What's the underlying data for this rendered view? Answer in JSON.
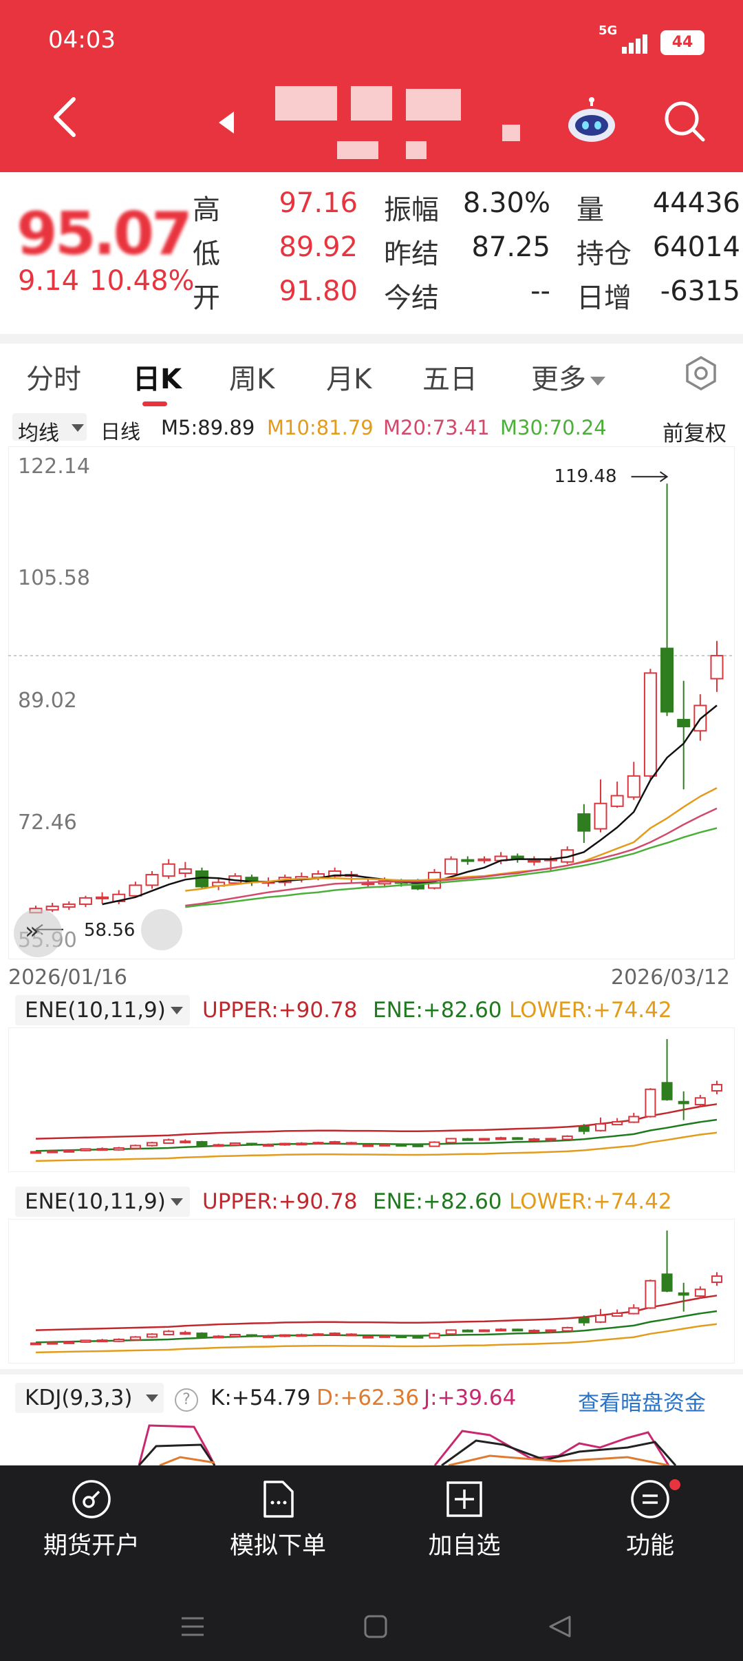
{
  "status_bar": {
    "time": "04:03",
    "network": "5G",
    "battery": "44"
  },
  "quote": {
    "price_obscured": "95.07",
    "change": "9.14",
    "change_pct": "10.48%",
    "rows": [
      [
        {
          "label": "高",
          "value": "97.16",
          "color": "red"
        },
        {
          "label": "振幅",
          "value": "8.30%",
          "color": "dark"
        },
        {
          "label": "量",
          "value": "44436",
          "color": "dark"
        }
      ],
      [
        {
          "label": "低",
          "value": "89.92",
          "color": "red"
        },
        {
          "label": "昨结",
          "value": "87.25",
          "color": "dark"
        },
        {
          "label": "持仓",
          "value": "64014",
          "color": "dark"
        }
      ],
      [
        {
          "label": "开",
          "value": "91.80",
          "color": "red"
        },
        {
          "label": "今结",
          "value": "--",
          "color": "dark"
        },
        {
          "label": "日增",
          "value": "-6315",
          "color": "dark"
        }
      ]
    ]
  },
  "tabs": [
    "分时",
    "日K",
    "周K",
    "月K",
    "五日",
    "更多"
  ],
  "ma_bar": {
    "avg_label": "均线",
    "line_type": "日线",
    "m5": "M5:89.89",
    "m10": "M10:81.79",
    "m20": "M20:73.41",
    "m30": "M30:70.24",
    "adjust": "前复权"
  },
  "colors": {
    "brand": "#e8343e",
    "up": "#d9363e",
    "down": "#2e7d1e",
    "m5": "#111111",
    "m10": "#e39b1b",
    "m20": "#d14a6b",
    "m30": "#4caf3a"
  },
  "chart_data": {
    "type": "candlestick",
    "ylim": [
      55.9,
      122.14
    ],
    "y_ticks": [
      "122.14",
      "105.58",
      "89.02",
      "72.46",
      "55.90"
    ],
    "y_tick_values": [
      122.14,
      105.58,
      89.02,
      72.46,
      55.9
    ],
    "high_label": "119.48",
    "low_label": "58.56",
    "date_start": "2026/01/16",
    "date_end": "2026/03/12",
    "current_price": 95.07,
    "candles": [
      [
        58.6,
        59.2,
        58.56,
        59.6
      ],
      [
        59.0,
        59.5,
        58.7,
        60.0
      ],
      [
        59.4,
        59.8,
        59.0,
        60.2
      ],
      [
        59.8,
        60.7,
        59.4,
        61.0
      ],
      [
        60.6,
        60.8,
        59.9,
        61.5
      ],
      [
        60.2,
        61.2,
        59.8,
        61.8
      ],
      [
        61.0,
        62.5,
        60.8,
        63.0
      ],
      [
        62.5,
        64.0,
        62.0,
        64.5
      ],
      [
        63.8,
        65.5,
        63.4,
        66.2
      ],
      [
        64.2,
        64.8,
        63.6,
        65.8
      ],
      [
        64.5,
        62.3,
        62.0,
        65.0
      ],
      [
        62.4,
        62.9,
        61.8,
        63.5
      ],
      [
        62.8,
        63.8,
        62.5,
        64.2
      ],
      [
        63.6,
        62.9,
        62.4,
        64.0
      ],
      [
        63.0,
        63.0,
        62.3,
        63.6
      ],
      [
        62.9,
        63.6,
        62.4,
        64.0
      ],
      [
        63.4,
        63.7,
        62.9,
        64.3
      ],
      [
        63.6,
        64.1,
        63.2,
        64.6
      ],
      [
        63.8,
        64.5,
        63.4,
        65.0
      ],
      [
        64.0,
        64.0,
        62.9,
        64.5
      ],
      [
        62.8,
        62.8,
        62.3,
        63.3
      ],
      [
        62.7,
        63.1,
        62.3,
        63.6
      ],
      [
        63.0,
        62.9,
        62.3,
        63.4
      ],
      [
        63.0,
        62.0,
        61.8,
        63.4
      ],
      [
        62.1,
        64.3,
        61.9,
        64.8
      ],
      [
        64.1,
        66.2,
        64.0,
        66.6
      ],
      [
        66.1,
        66.0,
        65.4,
        66.6
      ],
      [
        66.0,
        66.2,
        65.6,
        66.6
      ],
      [
        66.0,
        66.6,
        65.5,
        67.2
      ],
      [
        66.6,
        66.2,
        65.7,
        67.0
      ],
      [
        66.0,
        66.0,
        65.3,
        66.6
      ],
      [
        66.0,
        66.2,
        64.5,
        66.6
      ],
      [
        65.8,
        67.5,
        65.5,
        68.0
      ],
      [
        72.6,
        70.2,
        68.5,
        74.0
      ],
      [
        70.5,
        74.1,
        70.0,
        77.5
      ],
      [
        73.7,
        75.2,
        73.5,
        77.2
      ],
      [
        75.0,
        78.0,
        74.6,
        80.0
      ],
      [
        78.0,
        92.6,
        77.5,
        93.2
      ],
      [
        96.1,
        87.1,
        86.5,
        119.48
      ],
      [
        86.0,
        85.0,
        76.1,
        91.5
      ],
      [
        84.4,
        88.0,
        83.0,
        89.6
      ],
      [
        91.8,
        95.07,
        89.92,
        97.16
      ]
    ],
    "ma_series": [
      {
        "name": "M5",
        "values": [
          null,
          null,
          null,
          null,
          59.8,
          60.3,
          60.8,
          61.7,
          62.6,
          63.3,
          63.6,
          63.5,
          63.2,
          63.0,
          63.0,
          63.1,
          63.3,
          63.5,
          63.9,
          63.9,
          63.6,
          63.3,
          63.0,
          62.8,
          63.0,
          63.7,
          64.4,
          65.0,
          66.0,
          66.2,
          66.2,
          66.2,
          66.5,
          67.2,
          68.9,
          70.7,
          72.9,
          77.4,
          80.6,
          82.6,
          86.1,
          88.0
        ]
      },
      {
        "name": "M10",
        "values": [
          null,
          null,
          null,
          null,
          null,
          null,
          null,
          null,
          null,
          61.7,
          62.0,
          62.4,
          62.6,
          62.9,
          63.0,
          63.3,
          63.4,
          63.5,
          63.5,
          63.4,
          63.4,
          63.3,
          63.2,
          63.2,
          63.3,
          63.5,
          63.7,
          63.8,
          64.1,
          64.4,
          64.6,
          64.9,
          65.3,
          65.9,
          66.8,
          67.7,
          68.6,
          70.6,
          72.0,
          73.6,
          75.1,
          76.3
        ]
      },
      {
        "name": "M20",
        "values": [
          null,
          null,
          null,
          null,
          null,
          null,
          null,
          null,
          null,
          59.6,
          59.9,
          60.3,
          60.7,
          61.1,
          61.5,
          61.8,
          62.1,
          62.4,
          62.7,
          62.8,
          62.9,
          63.0,
          63.0,
          63.0,
          63.1,
          63.3,
          63.5,
          63.7,
          64.0,
          64.2,
          64.6,
          64.9,
          65.3,
          65.8,
          66.3,
          66.9,
          67.6,
          68.6,
          69.8,
          71.1,
          72.3,
          73.4
        ]
      },
      {
        "name": "M30",
        "values": [
          null,
          null,
          null,
          null,
          null,
          null,
          null,
          null,
          null,
          59.4,
          59.7,
          59.9,
          60.2,
          60.5,
          60.8,
          61.0,
          61.3,
          61.5,
          61.8,
          62.0,
          62.2,
          62.3,
          62.5,
          62.6,
          62.8,
          63.0,
          63.2,
          63.4,
          63.6,
          63.9,
          64.2,
          64.5,
          64.9,
          65.3,
          65.8,
          66.4,
          67.0,
          67.8,
          68.5,
          69.3,
          70.0,
          70.6
        ]
      }
    ]
  },
  "indicators": [
    {
      "name": "ENE(10,11,9)",
      "upper": "UPPER:+90.78",
      "ene": "ENE:+82.60",
      "lower": "LOWER:+74.42"
    },
    {
      "name": "ENE(10,11,9)",
      "upper": "UPPER:+90.78",
      "ene": "ENE:+82.60",
      "lower": "LOWER:+74.42"
    }
  ],
  "kdj": {
    "name": "KDJ(9,3,3)",
    "k": "K:+54.79",
    "d": "D:+62.36",
    "j": "J:+39.64",
    "link": "查看暗盘资金"
  },
  "bottom_nav": [
    {
      "label": "期货开户",
      "icon": "compass-icon"
    },
    {
      "label": "模拟下单",
      "icon": "document-icon"
    },
    {
      "label": "加自选",
      "icon": "plus-square-icon"
    },
    {
      "label": "功能",
      "icon": "menu-circle-icon"
    }
  ]
}
